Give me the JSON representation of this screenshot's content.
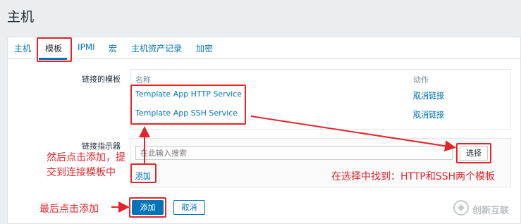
{
  "page": {
    "title": "主机"
  },
  "tabs": [
    {
      "label": "主机",
      "active": false
    },
    {
      "label": "模板",
      "active": true
    },
    {
      "label": "IPMI",
      "active": false
    },
    {
      "label": "宏",
      "active": false
    },
    {
      "label": "主机资产记录",
      "active": false
    },
    {
      "label": "加密",
      "active": false
    }
  ],
  "linked_templates": {
    "label": "链接的模板",
    "col_name": "名称",
    "col_action": "动作",
    "rows": [
      {
        "name": "Template App HTTP Service",
        "action": "取消链接"
      },
      {
        "name": "Template App SSH Service",
        "action": "取消链接"
      }
    ]
  },
  "link_indicator": {
    "label": "链接指示器",
    "search_placeholder": "在此输入搜索",
    "select_button": "选择",
    "add_link": "添加"
  },
  "form": {
    "add_button": "添加",
    "cancel_button": "取消"
  },
  "annotations": {
    "step_add_line1": "然后点击添加，提",
    "step_add_line2": "交到连接模板中",
    "step_select": "在选择中找到：HTTP和SSH两个模板",
    "step_final": "最后点击添加"
  },
  "watermark": {
    "text": "创新互联"
  },
  "colors": {
    "accent": "#0275b8",
    "annotation": "#e3252a",
    "background": "#ebeef0"
  }
}
